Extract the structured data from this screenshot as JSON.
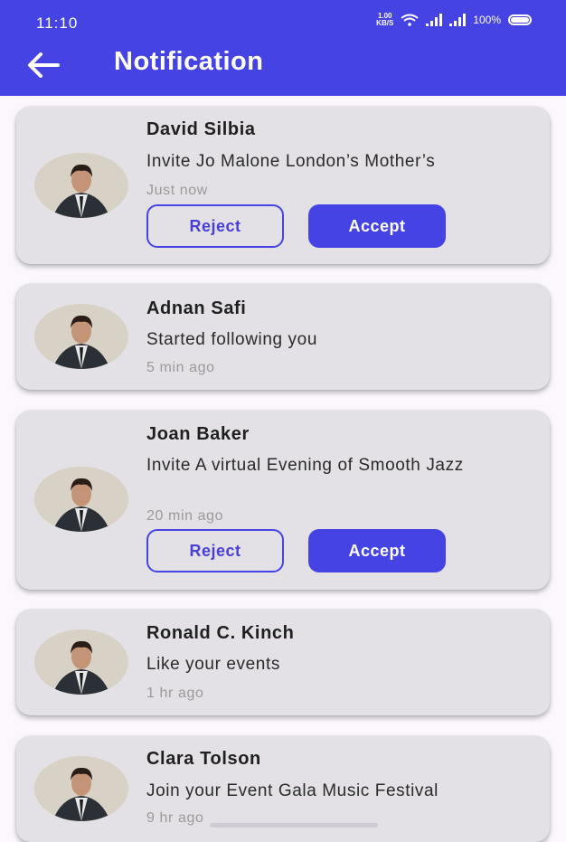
{
  "status_bar": {
    "time": "11:10",
    "speed_value": "1.00",
    "speed_unit": "KB/S",
    "battery": "100%"
  },
  "header": {
    "title": "Notification",
    "back_icon": "arrow-left-icon"
  },
  "notifications": [
    {
      "name": "David Silbia",
      "message": "Invite Jo Malone London’s Mother’s",
      "time": "Just now",
      "reject_label": "Reject",
      "accept_label": "Accept"
    },
    {
      "name": "Adnan Safi",
      "message": "Started following you",
      "time": "5 min ago"
    },
    {
      "name": "Joan Baker",
      "message": "Invite A virtual Evening of Smooth Jazz",
      "time": "20 min ago",
      "reject_label": "Reject",
      "accept_label": "Accept"
    },
    {
      "name": "Ronald C. Kinch",
      "message": "Like your events",
      "time": "1 hr ago"
    },
    {
      "name": "Clara Tolson",
      "message": "Join your Event Gala Music Festival",
      "time": "9 hr ago"
    }
  ],
  "colors": {
    "primary": "#4543e3",
    "card": "#e3e1e5",
    "background": "#fbf7fd"
  }
}
